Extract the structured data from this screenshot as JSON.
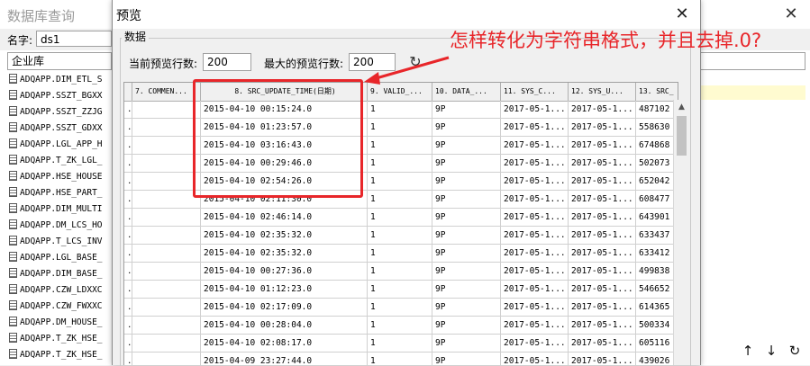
{
  "background_window": {
    "title": "数据库查询",
    "name_label": "名字:",
    "name_value": "ds1",
    "combo_value": "企业库",
    "tables": [
      "ADQAPP.DIM_ETL_S",
      "ADQAPP.SSZT_BGXX",
      "ADQAPP.SSZT_ZZJG",
      "ADQAPP.SSZT_GDXX",
      "ADQAPP.LGL_APP_H",
      "ADQAPP.T_ZK_LGL_",
      "ADQAPP.HSE_HOUSE",
      "ADQAPP.HSE_PART_",
      "ADQAPP.DIM_MULTI",
      "ADQAPP.DM_LCS_HO",
      "ADQAPP.T_LCS_INV",
      "ADQAPP.LGL_BASE_",
      "ADQAPP.DIM_BASE_",
      "ADQAPP.CZW_LDXXC",
      "ADQAPP.CZW_FWXXC",
      "ADQAPP.DM_HOUSE_",
      "ADQAPP.T_ZK_HSE_",
      "ADQAPP.T_ZK_HSE_"
    ],
    "buttons": {
      "up": "↑",
      "down": "↓",
      "refresh": "↻"
    }
  },
  "dialog": {
    "title": "预览",
    "group_label": "数据",
    "current_rows_label": "当前预览行数:",
    "current_rows_value": "200",
    "max_rows_label": "最大的预览行数:",
    "max_rows_value": "200",
    "columns": [
      {
        "label": "",
        "key": "mark"
      },
      {
        "label": "7. COMMEN...",
        "key": "c7"
      },
      {
        "label": "8. SRC_UPDATE_TIME(日期)",
        "key": "c8"
      },
      {
        "label": "9. VALID_...",
        "key": "c9"
      },
      {
        "label": "10. DATA_...",
        "key": "c10"
      },
      {
        "label": "11. SYS_C...",
        "key": "c11"
      },
      {
        "label": "12. SYS_U...",
        "key": "c12"
      },
      {
        "label": "13. SRC_",
        "key": "c13"
      }
    ],
    "rows": [
      {
        "mark": ".",
        "c7": "",
        "c8": "2015-04-10 00:15:24.0",
        "c9": "1",
        "c10": "9P",
        "c11": "2017-05-1...",
        "c12": "2017-05-1...",
        "c13": "487102"
      },
      {
        "mark": ".",
        "c7": "",
        "c8": "2015-04-10 01:23:57.0",
        "c9": "1",
        "c10": "9P",
        "c11": "2017-05-1...",
        "c12": "2017-05-1...",
        "c13": "558630"
      },
      {
        "mark": ".",
        "c7": "",
        "c8": "2015-04-10 03:16:43.0",
        "c9": "1",
        "c10": "9P",
        "c11": "2017-05-1...",
        "c12": "2017-05-1...",
        "c13": "674868"
      },
      {
        "mark": ".",
        "c7": "",
        "c8": "2015-04-10 00:29:46.0",
        "c9": "1",
        "c10": "9P",
        "c11": "2017-05-1...",
        "c12": "2017-05-1...",
        "c13": "502073"
      },
      {
        "mark": ".",
        "c7": "",
        "c8": "2015-04-10 02:54:26.0",
        "c9": "1",
        "c10": "9P",
        "c11": "2017-05-1...",
        "c12": "2017-05-1...",
        "c13": "652042"
      },
      {
        "mark": ".",
        "c7": "",
        "c8": "2015-04-10 02:11:30.0",
        "c9": "1",
        "c10": "9P",
        "c11": "2017-05-1...",
        "c12": "2017-05-1...",
        "c13": "608477"
      },
      {
        "mark": ".",
        "c7": "",
        "c8": "2015-04-10 02:46:14.0",
        "c9": "1",
        "c10": "9P",
        "c11": "2017-05-1...",
        "c12": "2017-05-1...",
        "c13": "643901"
      },
      {
        "mark": ".",
        "c7": "",
        "c8": "2015-04-10 02:35:32.0",
        "c9": "1",
        "c10": "9P",
        "c11": "2017-05-1...",
        "c12": "2017-05-1...",
        "c13": "633437"
      },
      {
        "mark": ".",
        "c7": "",
        "c8": "2015-04-10 02:35:32.0",
        "c9": "1",
        "c10": "9P",
        "c11": "2017-05-1...",
        "c12": "2017-05-1...",
        "c13": "633412"
      },
      {
        "mark": ".",
        "c7": "",
        "c8": "2015-04-10 00:27:36.0",
        "c9": "1",
        "c10": "9P",
        "c11": "2017-05-1...",
        "c12": "2017-05-1...",
        "c13": "499838"
      },
      {
        "mark": ".",
        "c7": "",
        "c8": "2015-04-10 01:12:23.0",
        "c9": "1",
        "c10": "9P",
        "c11": "2017-05-1...",
        "c12": "2017-05-1...",
        "c13": "546652"
      },
      {
        "mark": ".",
        "c7": "",
        "c8": "2015-04-10 02:17:09.0",
        "c9": "1",
        "c10": "9P",
        "c11": "2017-05-1...",
        "c12": "2017-05-1...",
        "c13": "614365"
      },
      {
        "mark": ".",
        "c7": "",
        "c8": "2015-04-10 00:28:04.0",
        "c9": "1",
        "c10": "9P",
        "c11": "2017-05-1...",
        "c12": "2017-05-1...",
        "c13": "500334"
      },
      {
        "mark": ".",
        "c7": "",
        "c8": "2015-04-10 02:08:17.0",
        "c9": "1",
        "c10": "9P",
        "c11": "2017-05-1...",
        "c12": "2017-05-1...",
        "c13": "605116"
      },
      {
        "mark": ".",
        "c7": "",
        "c8": "2015-04-09 23:27:44.0",
        "c9": "1",
        "c10": "9P",
        "c11": "2017-05-1...",
        "c12": "2017-05-1...",
        "c13": "439026"
      }
    ]
  },
  "annotation": {
    "text": "怎样转化为字符串格式，并且去掉.0?",
    "color": "#e8262a"
  }
}
